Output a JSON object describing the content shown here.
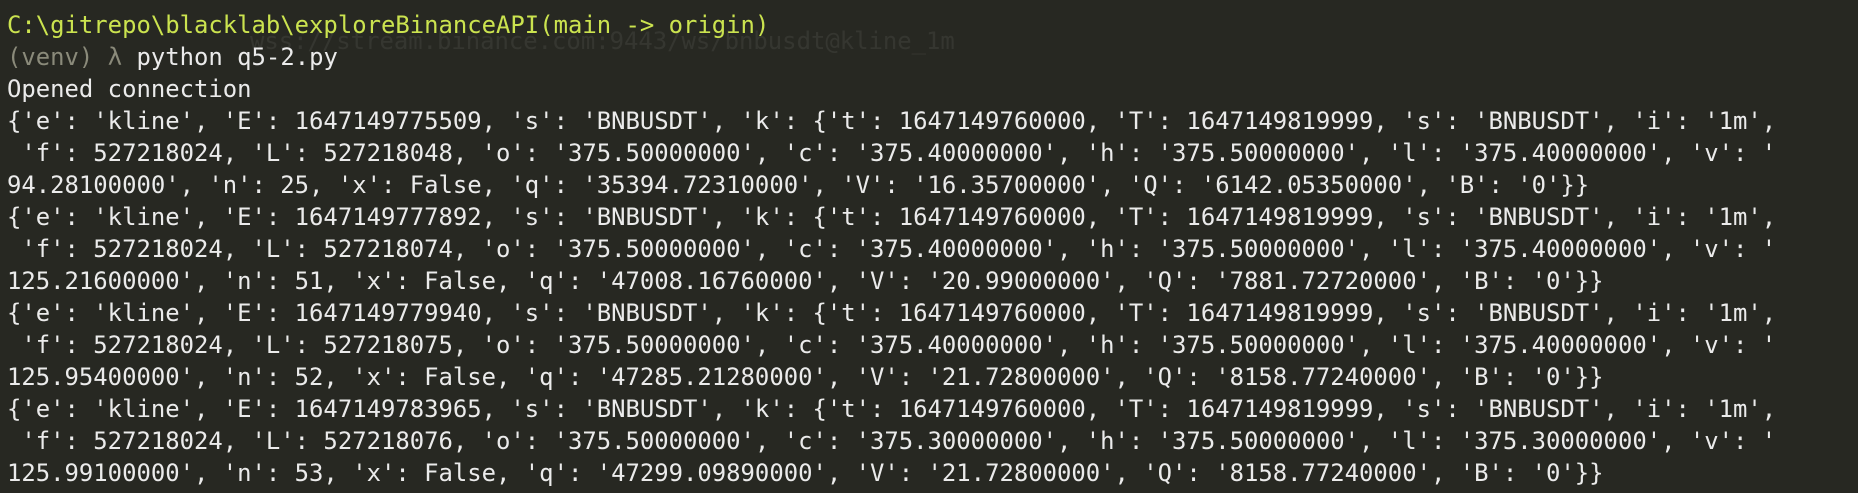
{
  "theme": {
    "background": "#272822",
    "text": "#ebebeb",
    "path_color": "#cbe34f",
    "muted_color": "#8a8a7a"
  },
  "prompt": {
    "path": "C:\\gitrepo\\blacklab\\exploreBinanceAPI",
    "branch": "(main -> origin)",
    "venv": "(venv)",
    "lambda": "λ",
    "command": "python q5-2.py"
  },
  "output_lines": [
    "Opened connection",
    "{'e': 'kline', 'E': 1647149775509, 's': 'BNBUSDT', 'k': {'t': 1647149760000, 'T': 1647149819999, 's': 'BNBUSDT', 'i': '1m',",
    " 'f': 527218024, 'L': 527218048, 'o': '375.50000000', 'c': '375.40000000', 'h': '375.50000000', 'l': '375.40000000', 'v': '",
    "94.28100000', 'n': 25, 'x': False, 'q': '35394.72310000', 'V': '16.35700000', 'Q': '6142.05350000', 'B': '0'}}",
    "{'e': 'kline', 'E': 1647149777892, 's': 'BNBUSDT', 'k': {'t': 1647149760000, 'T': 1647149819999, 's': 'BNBUSDT', 'i': '1m',",
    " 'f': 527218024, 'L': 527218074, 'o': '375.50000000', 'c': '375.40000000', 'h': '375.50000000', 'l': '375.40000000', 'v': '",
    "125.21600000', 'n': 51, 'x': False, 'q': '47008.16760000', 'V': '20.99000000', 'Q': '7881.72720000', 'B': '0'}}",
    "{'e': 'kline', 'E': 1647149779940, 's': 'BNBUSDT', 'k': {'t': 1647149760000, 'T': 1647149819999, 's': 'BNBUSDT', 'i': '1m',",
    " 'f': 527218024, 'L': 527218075, 'o': '375.50000000', 'c': '375.40000000', 'h': '375.50000000', 'l': '375.40000000', 'v': '",
    "125.95400000', 'n': 52, 'x': False, 'q': '47285.21280000', 'V': '21.72800000', 'Q': '8158.77240000', 'B': '0'}}",
    "{'e': 'kline', 'E': 1647149783965, 's': 'BNBUSDT', 'k': {'t': 1647149760000, 'T': 1647149819999, 's': 'BNBUSDT', 'i': '1m',",
    " 'f': 527218024, 'L': 527218076, 'o': '375.50000000', 'c': '375.30000000', 'h': '375.50000000', 'l': '375.30000000', 'v': '",
    "125.99100000', 'n': 53, 'x': False, 'q': '47299.09890000', 'V': '21.72800000', 'Q': '8158.77240000', 'B': '0'}}"
  ],
  "background_ghost_text": [
    "wss://stream.binance.com:9443/ws/bnbusdt@kline_1m"
  ]
}
